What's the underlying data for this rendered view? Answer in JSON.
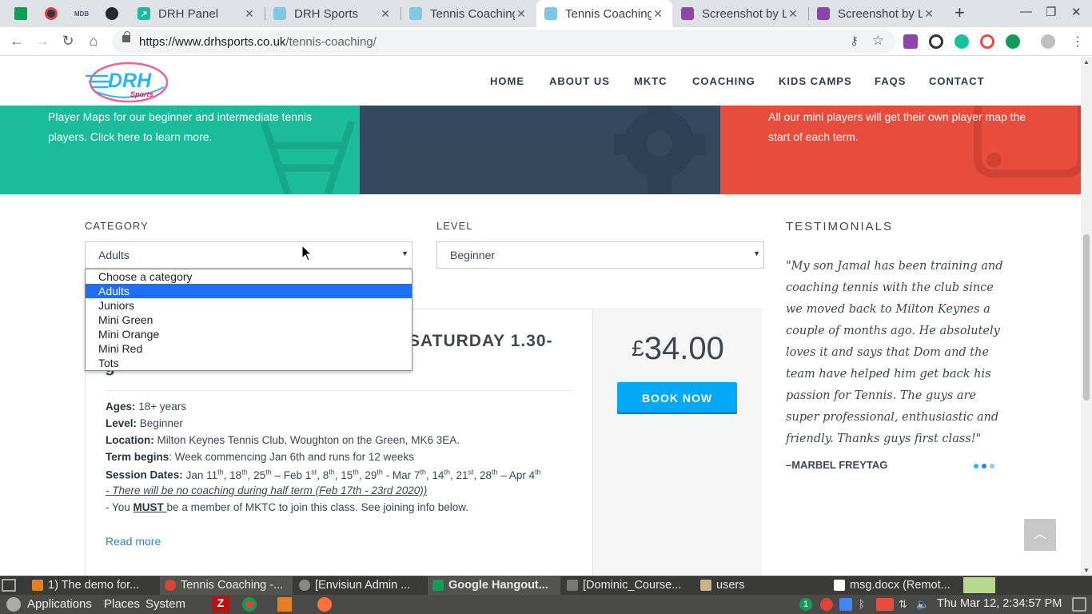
{
  "browser": {
    "tabs": [
      {
        "title": "DRH Panel"
      },
      {
        "title": "DRH Sports"
      },
      {
        "title": "Tennis Coaching"
      },
      {
        "title": "Tennis Coaching"
      },
      {
        "title": "Screenshot by L"
      },
      {
        "title": "Screenshot by L"
      }
    ],
    "new_tab": "+",
    "url_domain": "https://www.drhsports.co.uk",
    "url_path": "/tennis-coaching/"
  },
  "site": {
    "logo_text": "DRH",
    "logo_sub": "Sports",
    "nav": [
      "HOME",
      "ABOUT US",
      "MKTC",
      "COACHING",
      "KIDS CAMPS",
      "FAQS",
      "CONTACT"
    ],
    "banner_left": "Player Maps for our beginner and intermediate tennis players. Click here to learn more.",
    "banner_right": "All our mini players will get their own player map the start of each term.",
    "colors": {
      "green": "#1abc9c",
      "navy": "#34495e",
      "red": "#e74c3c",
      "accent": "#03a9f4"
    }
  },
  "filters": {
    "category_label": "CATEGORY",
    "category_value": "Adults",
    "level_label": "LEVEL",
    "level_value": "Beginner",
    "options": [
      "Choose a category",
      "Adults",
      "Juniors",
      "Mini Green",
      "Mini Orange",
      "Mini Red",
      "Tots"
    ],
    "selected_index": 1
  },
  "class": {
    "title_visible": "SATURDAY 1.30-",
    "title_line2": "g",
    "price_currency": "£",
    "price_amount": "34.00",
    "book_label": "BOOK NOW",
    "ages_label": "Ages:",
    "ages": "18+ years",
    "level_label": "Level:",
    "level": "Beginner",
    "location_label": "Location:",
    "location": "Milton Keynes Tennis Club, Woughton on the Green, MK6 3EA.",
    "term_label": "Term begins",
    "term": ": Week commencing Jan 6th and runs for 12 weeks",
    "dates_label": "Session Dates:",
    "dates": [
      {
        "d": "Jan 11",
        "s": "th"
      },
      {
        "d": ", 18",
        "s": "th"
      },
      {
        "d": ", 25",
        "s": "th"
      },
      {
        "d": " – Feb 1",
        "s": "st"
      },
      {
        "d": ",  8",
        "s": "th"
      },
      {
        "d": ", 15",
        "s": "th"
      },
      {
        "d": ", 29",
        "s": "th"
      },
      {
        "d": " - Mar 7",
        "s": "th"
      },
      {
        "d": ", 14",
        "s": "th"
      },
      {
        "d": ", 21",
        "s": "st"
      },
      {
        "d": ", 28",
        "s": "th"
      },
      {
        "d": " – Apr 4",
        "s": "th"
      }
    ],
    "half_term_note": "- There will be no coaching during half term (Feb 17th - 23rd 2020))",
    "member_pre": "- You ",
    "member_must": "MUST ",
    "member_post": "be a member of MKTC to join this class. See joining info below.",
    "read_more": "Read more"
  },
  "testimonials": {
    "heading": "TESTIMONIALS",
    "quote": "\"My son Jamal has been training and coaching tennis with the club since we moved back to Milton Keynes a couple of months ago. He absolutely loves it and says that Dom and the team have helped him get back his passion for Tennis. The guys are super professional, enthusiastic and friendly. Thanks guys first class!\"",
    "author": "–MARBEL FREYTAG",
    "active_dot": 1
  },
  "taskbar": {
    "tasks": [
      "1) The demo for...",
      "Tennis Coaching -...",
      "[Envisiun Admin ...",
      "Google Hangout...",
      "[Dominic_Course...",
      "users",
      "msg.docx (Remot..."
    ],
    "menus": [
      "Applications",
      "Places",
      "System"
    ],
    "clock": "Thu Mar 12,  2:34:57 PM",
    "badge": "1"
  }
}
